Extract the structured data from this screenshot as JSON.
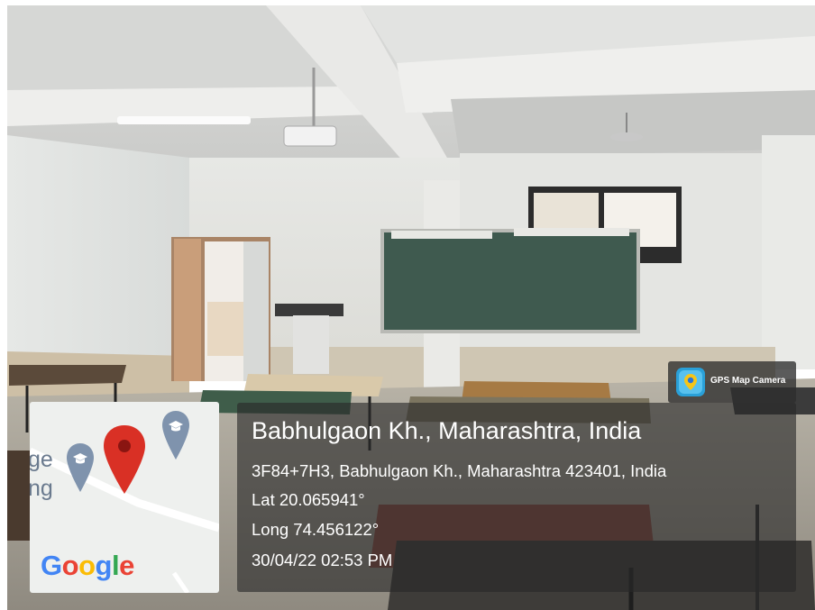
{
  "badge": {
    "label": "GPS Map Camera",
    "icon": "camera-pin-icon"
  },
  "map": {
    "text_line1": "ge",
    "text_line2": "ng",
    "logo": "Google",
    "logo_colors": [
      "#4285F4",
      "#EA4335",
      "#FBBC05",
      "#4285F4",
      "#34A853",
      "#EA4335"
    ],
    "pin_color": "#d93025",
    "school_marker_color": "#7f93ad"
  },
  "info": {
    "title": "Babhulgaon Kh., Maharashtra, India",
    "address": "3F84+7H3, Babhulgaon Kh., Maharashtra 423401, India",
    "lat": "Lat 20.065941°",
    "long": "Long 74.456122°",
    "datetime": "30/04/22 02:53 PM"
  }
}
